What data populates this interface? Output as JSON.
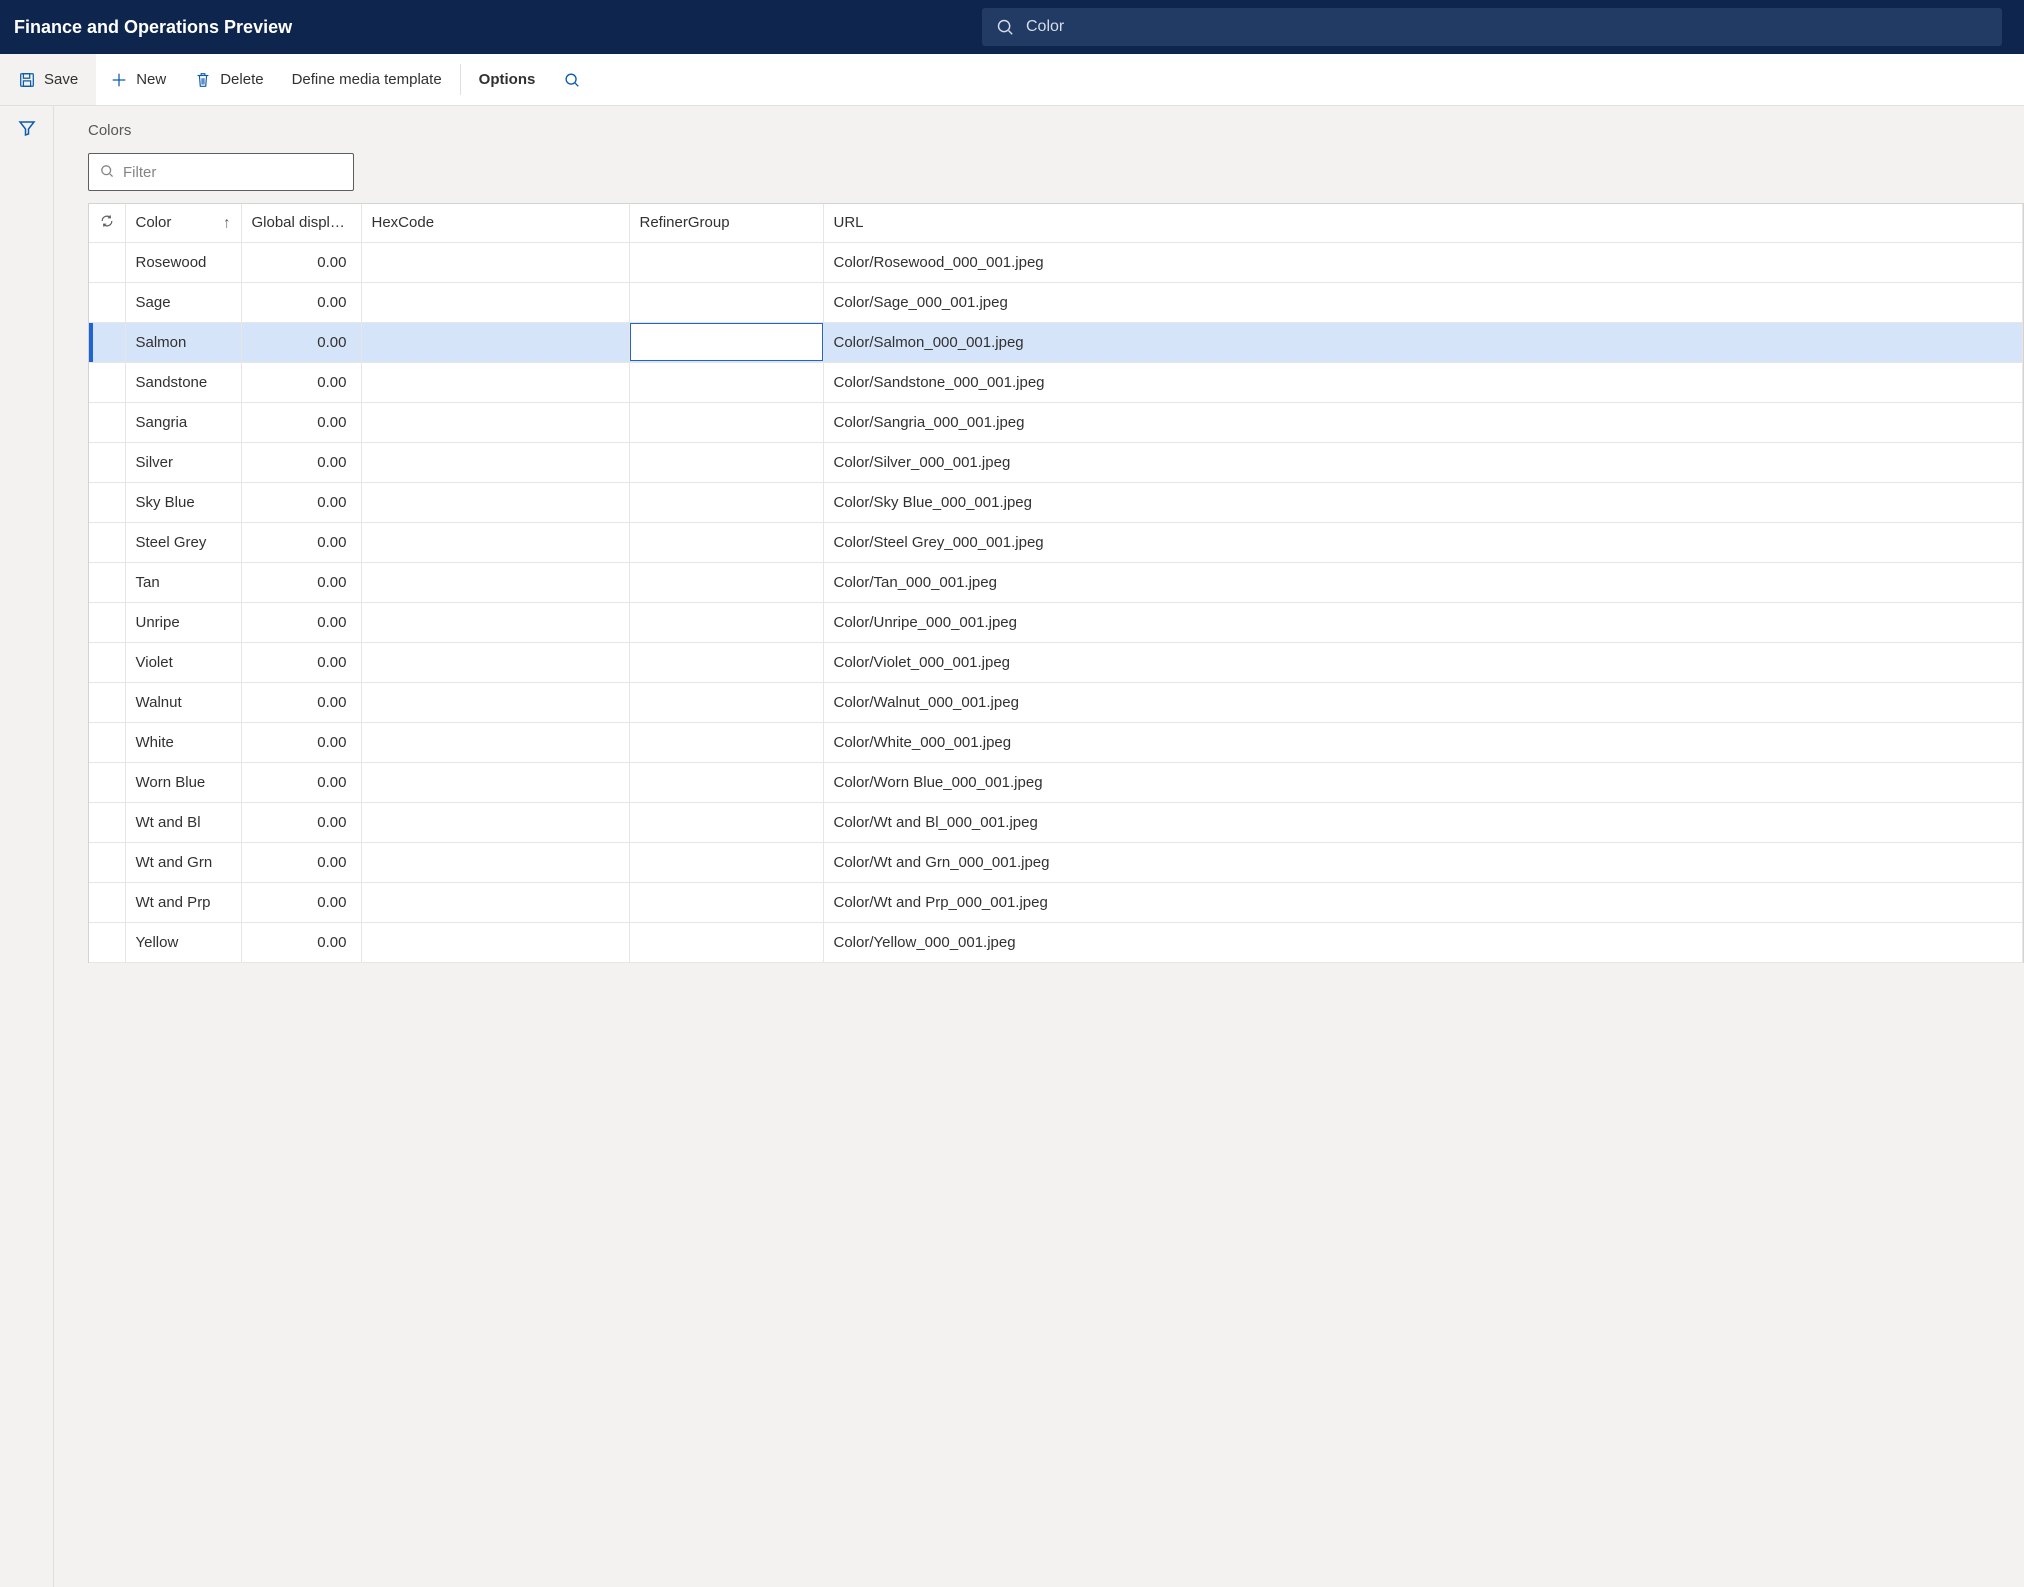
{
  "header": {
    "app_title": "Finance and Operations Preview",
    "search_value": "Color"
  },
  "actionbar": {
    "save": "Save",
    "new": "New",
    "delete": "Delete",
    "define_media_template": "Define media template",
    "options": "Options"
  },
  "page": {
    "title": "Colors",
    "filter_placeholder": "Filter"
  },
  "grid": {
    "columns": {
      "color": "Color",
      "global_display": "Global display …",
      "hexcode": "HexCode",
      "refiner_group": "RefinerGroup",
      "url": "URL"
    },
    "sort_indicator": "↑",
    "selected_index": 2,
    "editing_column": "refiner",
    "rows": [
      {
        "color": "Rosewood",
        "display": "0.00",
        "hex": "",
        "refiner": "",
        "url": "Color/Rosewood_000_001.jpeg"
      },
      {
        "color": "Sage",
        "display": "0.00",
        "hex": "",
        "refiner": "",
        "url": "Color/Sage_000_001.jpeg"
      },
      {
        "color": "Salmon",
        "display": "0.00",
        "hex": "",
        "refiner": "",
        "url": "Color/Salmon_000_001.jpeg"
      },
      {
        "color": "Sandstone",
        "display": "0.00",
        "hex": "",
        "refiner": "",
        "url": "Color/Sandstone_000_001.jpeg"
      },
      {
        "color": "Sangria",
        "display": "0.00",
        "hex": "",
        "refiner": "",
        "url": "Color/Sangria_000_001.jpeg"
      },
      {
        "color": "Silver",
        "display": "0.00",
        "hex": "",
        "refiner": "",
        "url": "Color/Silver_000_001.jpeg"
      },
      {
        "color": "Sky Blue",
        "display": "0.00",
        "hex": "",
        "refiner": "",
        "url": "Color/Sky Blue_000_001.jpeg"
      },
      {
        "color": "Steel Grey",
        "display": "0.00",
        "hex": "",
        "refiner": "",
        "url": "Color/Steel Grey_000_001.jpeg"
      },
      {
        "color": "Tan",
        "display": "0.00",
        "hex": "",
        "refiner": "",
        "url": "Color/Tan_000_001.jpeg"
      },
      {
        "color": "Unripe",
        "display": "0.00",
        "hex": "",
        "refiner": "",
        "url": "Color/Unripe_000_001.jpeg"
      },
      {
        "color": "Violet",
        "display": "0.00",
        "hex": "",
        "refiner": "",
        "url": "Color/Violet_000_001.jpeg"
      },
      {
        "color": "Walnut",
        "display": "0.00",
        "hex": "",
        "refiner": "",
        "url": "Color/Walnut_000_001.jpeg"
      },
      {
        "color": "White",
        "display": "0.00",
        "hex": "",
        "refiner": "",
        "url": "Color/White_000_001.jpeg"
      },
      {
        "color": "Worn Blue",
        "display": "0.00",
        "hex": "",
        "refiner": "",
        "url": "Color/Worn Blue_000_001.jpeg"
      },
      {
        "color": "Wt and Bl",
        "display": "0.00",
        "hex": "",
        "refiner": "",
        "url": "Color/Wt and Bl_000_001.jpeg"
      },
      {
        "color": "Wt and Grn",
        "display": "0.00",
        "hex": "",
        "refiner": "",
        "url": "Color/Wt and Grn_000_001.jpeg"
      },
      {
        "color": "Wt and Prp",
        "display": "0.00",
        "hex": "",
        "refiner": "",
        "url": "Color/Wt and Prp_000_001.jpeg"
      },
      {
        "color": "Yellow",
        "display": "0.00",
        "hex": "",
        "refiner": "",
        "url": "Color/Yellow_000_001.jpeg"
      }
    ]
  }
}
